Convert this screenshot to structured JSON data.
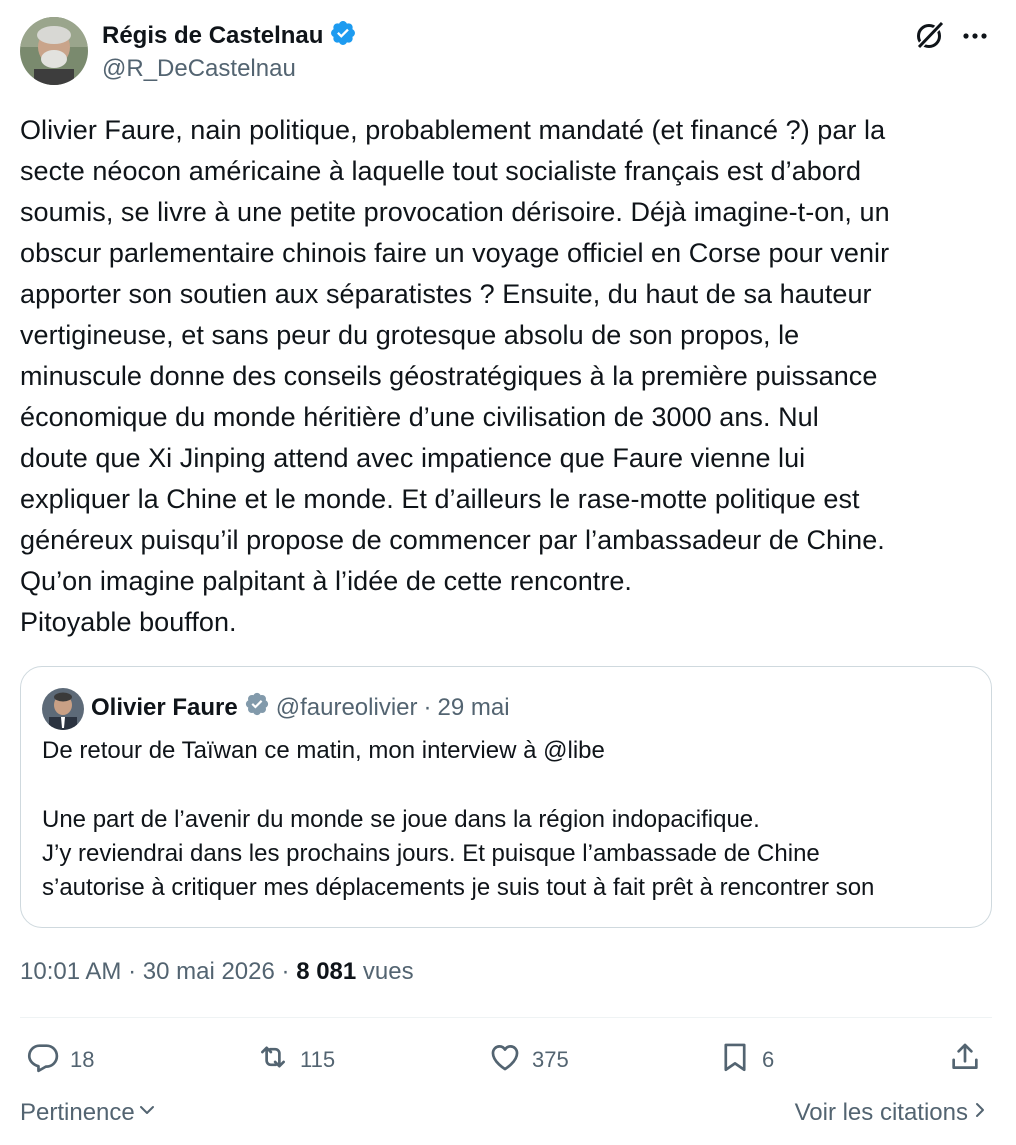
{
  "author": {
    "name": "Régis de Castelnau",
    "handle": "@R_DeCastelnau"
  },
  "icons": {
    "verified": "verified-badge-icon",
    "grok": "grok-icon",
    "more": "more-dots-icon",
    "reply": "reply-icon",
    "retweet": "retweet-icon",
    "like": "heart-icon",
    "bookmark": "bookmark-icon",
    "share": "share-icon",
    "chevron_down": "chevron-down-icon",
    "chevron_right": "chevron-right-icon"
  },
  "colors": {
    "verified_blue": "#1d9bf0",
    "verified_gray": "#829aab",
    "secondary_text": "#536471",
    "primary_text": "#0f1419",
    "border": "#cfd9de"
  },
  "tweet": {
    "text": "Olivier Faure, nain politique, probablement mandaté (et financé ?) par la\nsecte néocon américaine à laquelle tout socialiste français est d’abord\nsoumis, se livre à une petite provocation dérisoire. Déjà imagine-t-on, un\nobscur parlementaire chinois faire un voyage officiel en Corse pour venir\napporter son soutien aux séparatistes ? Ensuite, du haut de sa hauteur\nvertigineuse, et sans peur du grotesque absolu de son propos, le\nminuscule donne des conseils géostratégiques à la première puissance\néconomique du monde héritière d’une civilisation de 3000 ans. Nul\ndoute que Xi Jinping attend avec impatience que Faure vienne lui\nexpliquer la Chine et le monde. Et d’ailleurs le rase-motte politique est\ngénéreux puisqu’il propose de commencer par l’ambassadeur de Chine.\nQu’on imagine palpitant à l’idée de cette rencontre.\nPitoyable bouffon."
  },
  "quote": {
    "name": "Olivier Faure",
    "handle": "@faureolivier",
    "separator": "·",
    "date": "29 mai",
    "lines": [
      "De retour de Taïwan ce matin, mon interview à @libe",
      "Une part de l’avenir du monde se joue dans la région indopacifique.",
      "J’y reviendrai dans les prochains jours. Et puisque l’ambassade de Chine",
      "s’autorise à critiquer mes déplacements je suis tout à fait prêt à rencontrer son"
    ]
  },
  "meta": {
    "time": "10:01 AM",
    "separator": "·",
    "date": "30 mai 2026",
    "views_count": "8 081",
    "views_label": "vues"
  },
  "actions": {
    "replies": "18",
    "retweets": "115",
    "likes": "375",
    "bookmarks": "6"
  },
  "footer": {
    "sort_label": "Pertinence",
    "quotes_label": "Voir les citations"
  }
}
